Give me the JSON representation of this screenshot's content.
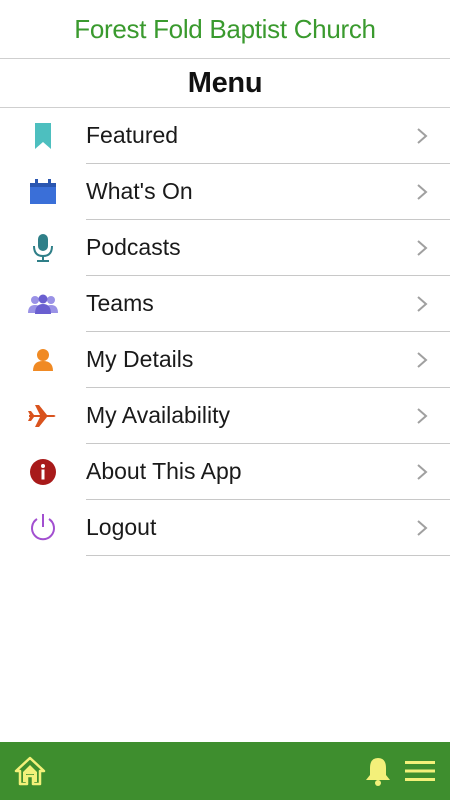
{
  "header": {
    "title": "Forest Fold Baptist Church"
  },
  "menu": {
    "title": "Menu",
    "items": [
      {
        "label": "Featured",
        "icon": "bookmark-icon",
        "color": "#4dbfbf"
      },
      {
        "label": "What's On",
        "icon": "calendar-icon",
        "color": "#3a6fd8"
      },
      {
        "label": "Podcasts",
        "icon": "microphone-icon",
        "color": "#2f7f88"
      },
      {
        "label": "Teams",
        "icon": "people-group-icon",
        "color": "#7a70d8"
      },
      {
        "label": "My Details",
        "icon": "person-icon",
        "color": "#f08a24"
      },
      {
        "label": "My Availability",
        "icon": "airplane-icon",
        "color": "#d9531e"
      },
      {
        "label": "About This App",
        "icon": "info-icon",
        "color": "#a81a1a"
      },
      {
        "label": "Logout",
        "icon": "power-icon",
        "color": "#a24fd0"
      }
    ]
  },
  "bottom_bar": {
    "background": "#3e8e2e",
    "icon_color": "#f3f07a",
    "home_icon": "home-icon",
    "bell_icon": "bell-icon",
    "menu_icon": "hamburger-menu-icon"
  }
}
